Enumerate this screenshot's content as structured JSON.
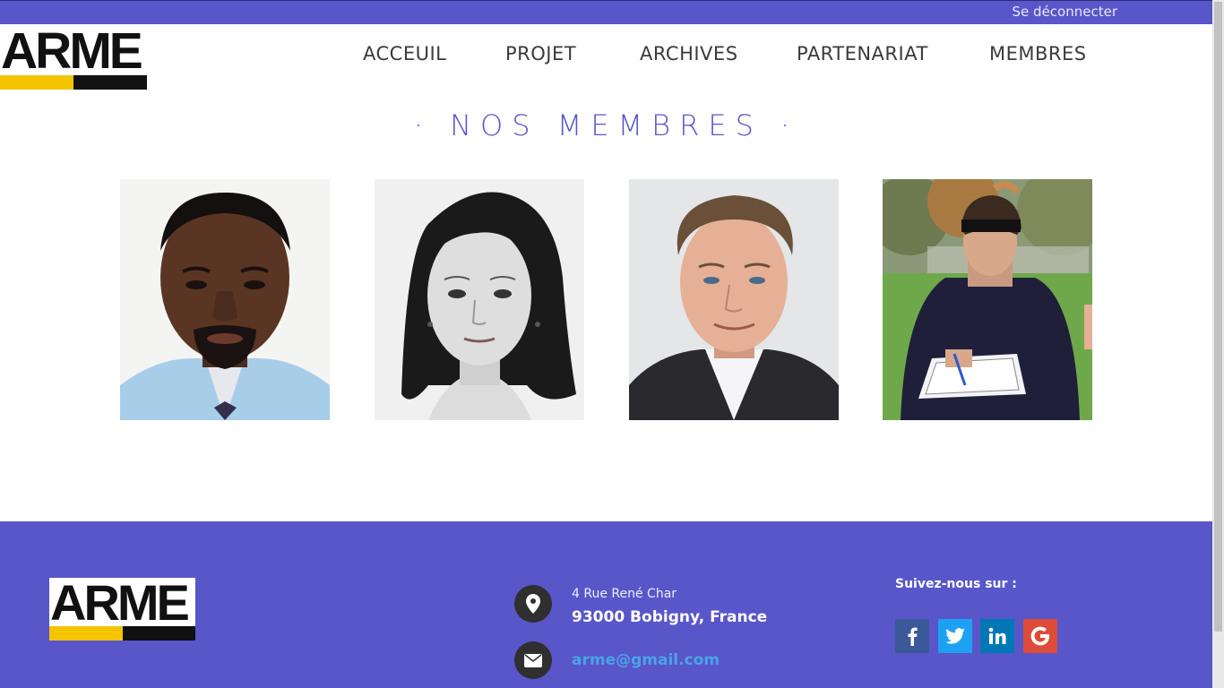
{
  "topbar": {
    "logout_label": "Se déconnecter",
    "color": "#5856c9"
  },
  "logo": {
    "text": "ARME"
  },
  "nav": {
    "items": [
      {
        "label": "ACCEUIL"
      },
      {
        "label": "PROJET"
      },
      {
        "label": "ARCHIVES"
      },
      {
        "label": "PARTENARIAT"
      },
      {
        "label": "MEMBRES"
      }
    ]
  },
  "members": {
    "title": "· NOS MEMBRES ·",
    "photos": [
      {
        "icon": "member-photo-man-blue-shirt"
      },
      {
        "icon": "member-photo-woman-black-white"
      },
      {
        "icon": "member-photo-man-suit"
      },
      {
        "icon": "member-photo-woman-outdoors-clipboard"
      }
    ]
  },
  "footer": {
    "color": "#5856c9",
    "address_line1": "4 Rue René Char",
    "address_line2": "93000 Bobigny, France",
    "email": "arme@gmail.com",
    "follow_label": "Suivez-nous sur :",
    "social": [
      {
        "icon": "facebook-icon",
        "color": "#3b5998"
      },
      {
        "icon": "twitter-icon",
        "color": "#1da1f2"
      },
      {
        "icon": "linkedin-icon",
        "color": "#0077b5"
      },
      {
        "icon": "google-icon",
        "color": "#dd4b39"
      }
    ]
  }
}
